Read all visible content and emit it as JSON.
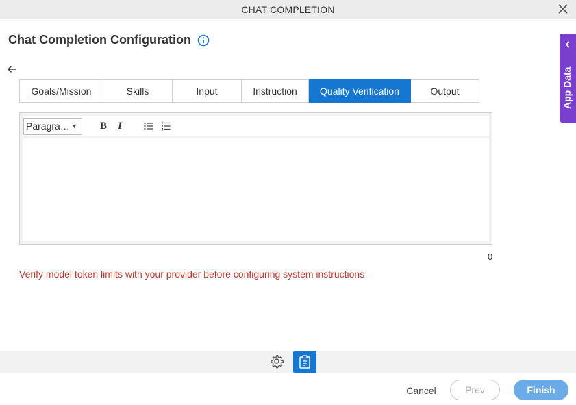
{
  "titlebar": {
    "title": "CHAT COMPLETION",
    "close_icon": "close-icon"
  },
  "header": {
    "title": "Chat Completion Configuration",
    "info_icon": "info-icon"
  },
  "back_icon": "arrow-left-icon",
  "tabs": [
    {
      "label": "Goals/Mission",
      "active": false
    },
    {
      "label": "Skills",
      "active": false
    },
    {
      "label": "Input",
      "active": false
    },
    {
      "label": "Instruction",
      "active": false
    },
    {
      "label": "Quality Verification",
      "active": true
    },
    {
      "label": "Output",
      "active": false
    }
  ],
  "editor": {
    "format_value": "Paragra…",
    "bold_label": "B",
    "italic_label": "I",
    "content": "",
    "char_count": "0"
  },
  "warning": "Verify model token limits with your provider before configuring system instructions",
  "footer": {
    "cancel_label": "Cancel",
    "prev_label": "Prev",
    "finish_label": "Finish"
  },
  "side_panel": {
    "label": "App Data"
  },
  "colors": {
    "accent": "#1677d2",
    "side_panel": "#7b3fcf",
    "warning": "#c0392b",
    "finish": "#6aabe8"
  }
}
